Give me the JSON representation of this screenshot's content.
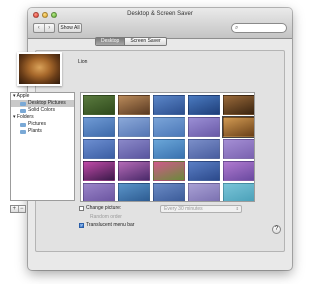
{
  "window": {
    "title": "Desktop & Screen Saver",
    "show_all_label": "Show All",
    "nav_back": "‹",
    "nav_forward": "›"
  },
  "search": {
    "placeholder": "",
    "icon": "search-icon"
  },
  "tabs": [
    {
      "label": "Desktop",
      "selected": true
    },
    {
      "label": "Screen Saver",
      "selected": false
    }
  ],
  "current": {
    "name": "Lion"
  },
  "sidebar": {
    "groups": [
      {
        "label": "Apple",
        "items": [
          {
            "label": "Desktop Pictures",
            "selected": true
          },
          {
            "label": "Solid Colors",
            "selected": false
          }
        ]
      },
      {
        "label": "Folders",
        "items": [
          {
            "label": "Pictures",
            "selected": false
          },
          {
            "label": "Plants",
            "selected": false
          }
        ]
      }
    ]
  },
  "thumbnails": [
    {
      "c1": "#5a7a3e",
      "c2": "#2f4a1c"
    },
    {
      "c1": "#b98a5a",
      "c2": "#5a3a22"
    },
    {
      "c1": "#5b86c8",
      "c2": "#2c4f8f"
    },
    {
      "c1": "#4a7ac0",
      "c2": "#1f3f7a"
    },
    {
      "c1": "#9a6a3a",
      "c2": "#3a2410"
    },
    {
      "c1": "#6f9ad4",
      "c2": "#3e6aaa"
    },
    {
      "c1": "#8aa8d8",
      "c2": "#5676b4"
    },
    {
      "c1": "#7aa4d8",
      "c2": "#4c78b8"
    },
    {
      "c1": "#9a8ed4",
      "c2": "#6a5aa8"
    },
    {
      "c1": "#d19a52",
      "c2": "#6a4018"
    },
    {
      "c1": "#6c8ed0",
      "c2": "#3c5ea4"
    },
    {
      "c1": "#8a88c8",
      "c2": "#5a56a0"
    },
    {
      "c1": "#6aa6d8",
      "c2": "#3a72b0"
    },
    {
      "c1": "#7a8ec8",
      "c2": "#4a5ea0"
    },
    {
      "c1": "#a48ed4",
      "c2": "#7a62b0"
    },
    {
      "c1": "#c04aa8",
      "c2": "#3a1a4a"
    },
    {
      "c1": "#b46ab6",
      "c2": "#4a2a6a"
    },
    {
      "c1": "#d05a8a",
      "c2": "#6a8a3a"
    },
    {
      "c1": "#5a7ec4",
      "c2": "#2c4a8c"
    },
    {
      "c1": "#b07ad0",
      "c2": "#6a4aa0"
    },
    {
      "c1": "#9a84c8",
      "c2": "#6a54a0"
    },
    {
      "c1": "#5a94c8",
      "c2": "#2c5a90"
    },
    {
      "c1": "#6a8ac4",
      "c2": "#3a5a98"
    },
    {
      "c1": "#a8a0d4",
      "c2": "#7a70b0"
    },
    {
      "c1": "#7ac4d8",
      "c2": "#4aa0b8"
    }
  ],
  "selected_thumbnail": 9,
  "add_button": "+",
  "remove_button": "−",
  "options": {
    "change_picture_label": "Change picture:",
    "change_picture_checked": false,
    "interval_value": "Every 30 minutes",
    "random_order_label": "Random order",
    "random_order_checked": false,
    "translucent_label": "Translucent menu bar",
    "translucent_checked": true
  },
  "help_label": "?"
}
